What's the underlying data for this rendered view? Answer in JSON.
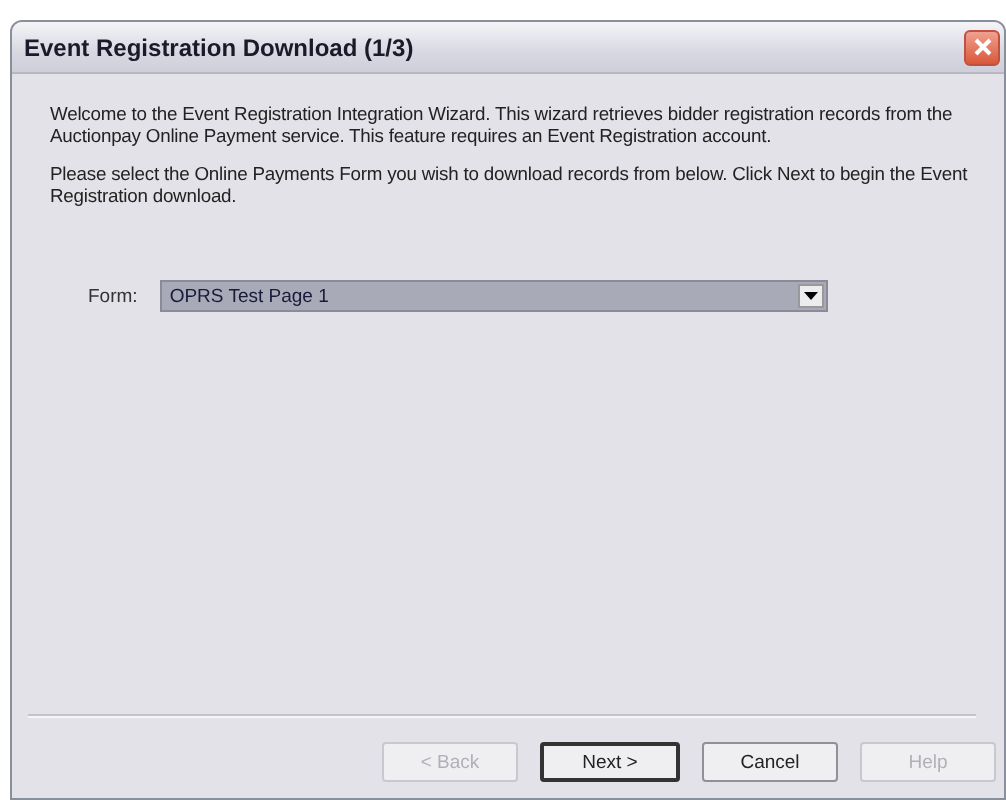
{
  "window": {
    "title": "Event Registration Download (1/3)"
  },
  "intro": [
    "Welcome to the Event Registration Integration Wizard.  This wizard retrieves bidder registration records from the Auctionpay Online Payment service.  This feature requires an Event Registration account.",
    "Please select the Online Payments Form you wish to download records from below.  Click Next to begin the Event Registration download."
  ],
  "form_field": {
    "label": "Form:",
    "value": "OPRS Test Page 1"
  },
  "buttons": [
    {
      "label": "< Back",
      "disabled": true,
      "default": false
    },
    {
      "label": "Next >",
      "disabled": false,
      "default": true
    },
    {
      "label": "Cancel",
      "disabled": false,
      "default": false
    },
    {
      "label": "Help",
      "disabled": true,
      "default": false
    }
  ]
}
